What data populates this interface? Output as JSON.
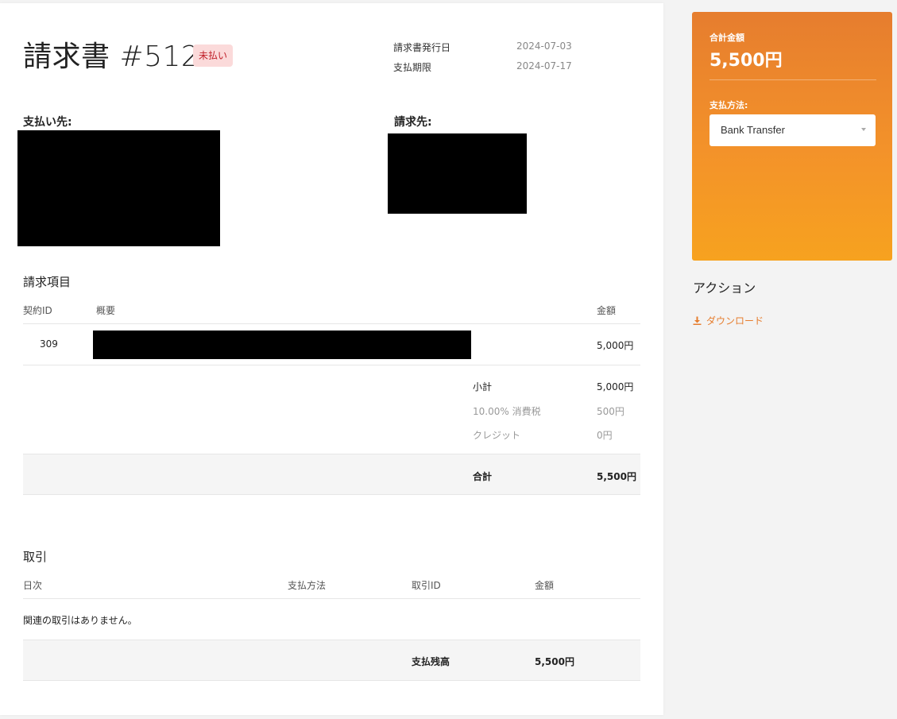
{
  "invoice": {
    "title": "請求書 #512",
    "status_badge": "未払い",
    "issue_date_label": "請求書発行日",
    "issue_date": "2024-07-03",
    "due_date_label": "支払期限",
    "due_date": "2024-07-17",
    "pay_to_label": "支払い先:",
    "bill_to_label": "請求先:"
  },
  "items": {
    "section_title": "請求項目",
    "headers": [
      "契約ID",
      "概要",
      "金額"
    ],
    "rows": [
      {
        "contract_id": "309",
        "amount": "5,000円"
      }
    ],
    "subtotal_label": "小計",
    "subtotal": "5,000円",
    "tax_label": "10.00% 消費税",
    "tax": "500円",
    "credit_label": "クレジット",
    "credit": "0円",
    "total_label": "合計",
    "total": "5,500円"
  },
  "transactions": {
    "section_title": "取引",
    "headers": [
      "日次",
      "支払方法",
      "取引ID",
      "金額"
    ],
    "empty_message": "関連の取引はありません。",
    "balance_label": "支払残高",
    "balance": "5,500円"
  },
  "summary": {
    "total_label": "合計金額",
    "total_value": "5,500円",
    "payment_method_label": "支払方法:",
    "payment_method_selected": "Bank Transfer",
    "accent_color": "#e67d2e"
  },
  "actions": {
    "title": "アクション",
    "download_label": "ダウンロード"
  },
  "icons": {
    "download": "download-icon",
    "select_caret": "chevron-down-icon"
  }
}
